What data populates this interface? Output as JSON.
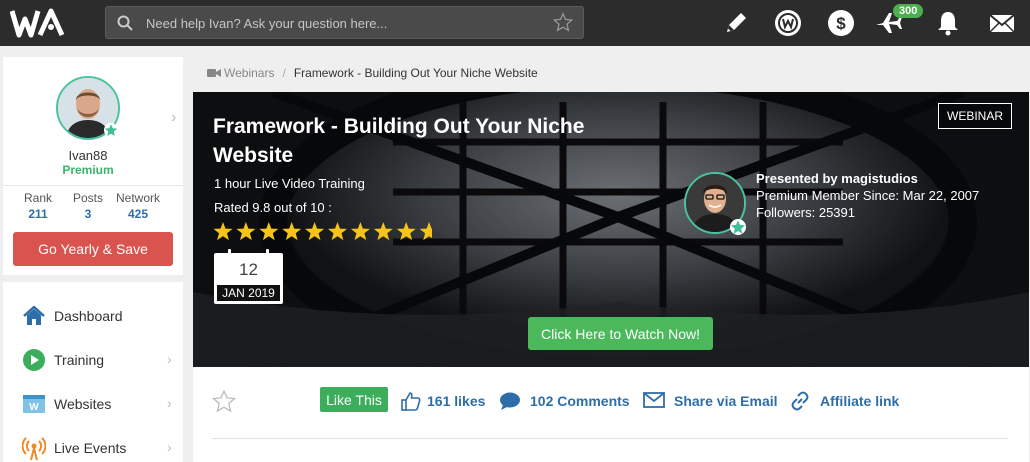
{
  "header": {
    "search_placeholder": "Need help Ivan? Ask your question here...",
    "notification_count": "300",
    "icons": [
      "pencil-icon",
      "wa-circle-icon",
      "dollar-icon",
      "plane-icon",
      "bell-icon",
      "mail-icon"
    ],
    "bar_color": "#2c2c2c"
  },
  "profile": {
    "username": "Ivan88",
    "membership": "Premium",
    "stats": [
      {
        "label": "Rank",
        "value": "211"
      },
      {
        "label": "Posts",
        "value": "3"
      },
      {
        "label": "Network",
        "value": "425"
      }
    ],
    "cta_label": "Go Yearly & Save"
  },
  "sidebar": {
    "items": [
      {
        "label": "Dashboard",
        "icon": "home-icon"
      },
      {
        "label": "Training",
        "icon": "play-icon"
      },
      {
        "label": "Websites",
        "icon": "website-icon"
      },
      {
        "label": "Live Events",
        "icon": "broadcast-icon"
      }
    ]
  },
  "breadcrumb": {
    "parent": "Webinars",
    "separator": "/",
    "current": "Framework - Building Out Your Niche Website"
  },
  "webinar": {
    "title": "Framework - Building Out Your Niche Website",
    "subtitle": "1 hour Live Video Training",
    "rating_text": "Rated 9.8 out of 10 :",
    "star_count": 10,
    "date_day": "12",
    "date_month_year": "JAN 2019",
    "tag": "WEBINAR",
    "presenter": {
      "by": "Presented by magistudios",
      "since": "Premium Member Since: Mar 22, 2007",
      "followers": "Followers: 25391"
    },
    "watch_label": "Click Here to Watch Now!"
  },
  "actions": {
    "like_label": "Like This",
    "likes": "161 likes",
    "comments": "102 Comments",
    "share": "Share via Email",
    "affiliate": "Affiliate link"
  },
  "colors": {
    "accent": "#2d6ea8",
    "premium": "#3bb36a",
    "cta": "#d9534f",
    "watch": "#4cb85c",
    "star": "#f6c31a"
  }
}
